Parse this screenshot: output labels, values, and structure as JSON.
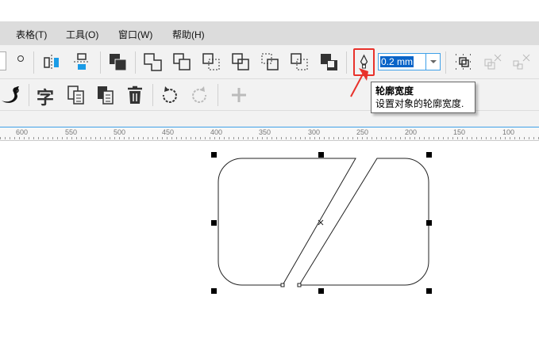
{
  "menu": [
    "表格(T)",
    "工具(O)",
    "窗口(W)",
    "帮助(H)"
  ],
  "outline_width": {
    "value": "0.2 mm"
  },
  "tooltip": {
    "title": "轮廓宽度",
    "text": "设置对象的轮廓宽度."
  },
  "toolbar2": {
    "text_icon": "字"
  },
  "ruler": [
    "600",
    "550",
    "500",
    "450",
    "400",
    "350",
    "300",
    "250",
    "200",
    "150",
    "100"
  ],
  "colors": {
    "highlight": "#e8322b",
    "accent": "#0a64c8",
    "blue_icon": "#1a9be6"
  }
}
